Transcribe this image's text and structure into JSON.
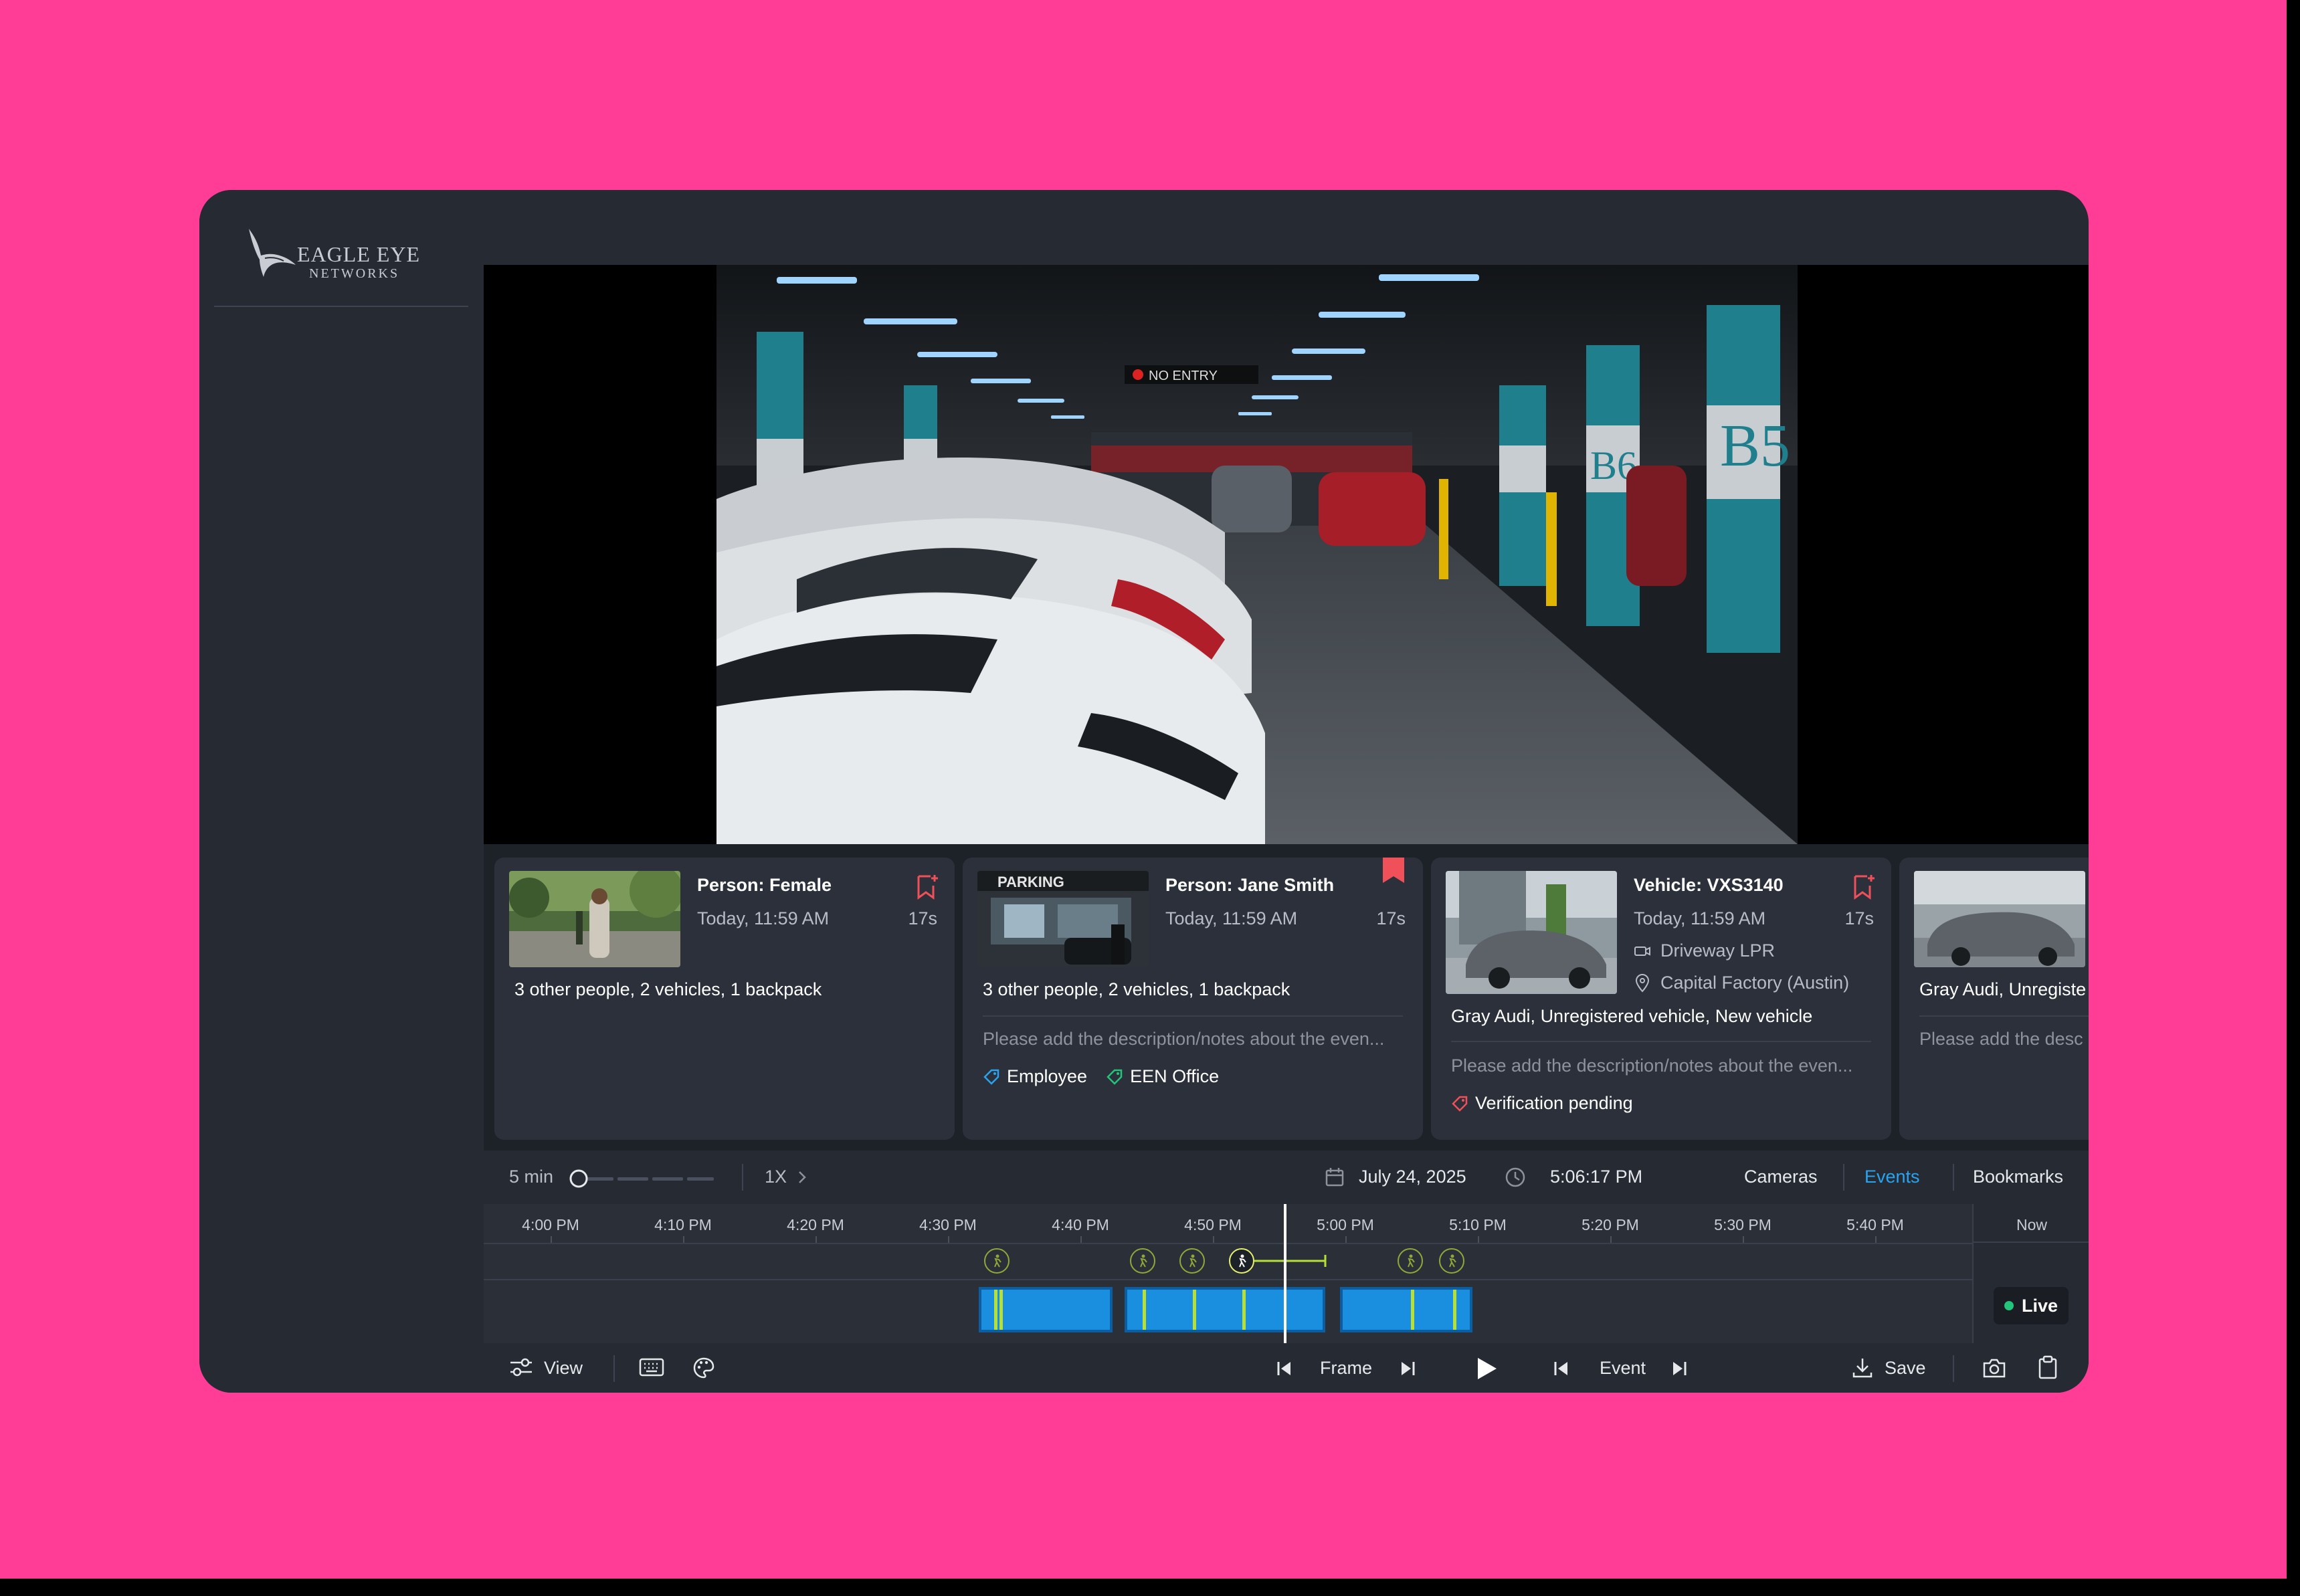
{
  "brand": {
    "name_line1": "EAGLE EYE",
    "name_line2": "NETWORKS"
  },
  "video": {
    "sign_text": "NO ENTRY",
    "pillar_label": "B5",
    "pillar_label2": "B6"
  },
  "events": [
    {
      "title": "Person: Female",
      "time": "Today, 11:59 AM",
      "duration": "17s",
      "summary": "3 other people, 2 vehicles, 1 backpack",
      "bookmarked": false
    },
    {
      "title": "Person: Jane Smith",
      "time": "Today, 11:59 AM",
      "duration": "17s",
      "summary": "3 other people, 2 vehicles, 1 backpack",
      "notes_placeholder": "Please add the description/notes about the even...",
      "thumb_text": "PARKING",
      "bookmarked": true,
      "tags": [
        {
          "label": "Employee",
          "color": "#2aa3f0"
        },
        {
          "label": "EEN Office",
          "color": "#22c57a"
        }
      ]
    },
    {
      "title": "Vehicle: VXS3140",
      "time": "Today, 11:59 AM",
      "duration": "17s",
      "camera": "Driveway LPR",
      "location": "Capital Factory (Austin)",
      "summary": "Gray Audi, Unregistered vehicle, New vehicle",
      "notes_placeholder": "Please add the description/notes about the even...",
      "bookmarked": false,
      "tags": [
        {
          "label": "Verification pending",
          "color": "#f0505a"
        }
      ]
    },
    {
      "summary": "Gray Audi, Unregiste",
      "notes_placeholder": "Please add the desc"
    }
  ],
  "toolbar": {
    "zoom_label": "5 min",
    "speed": "1X",
    "date": "July 24, 2025",
    "time": "5:06:17 PM",
    "tabs": [
      "Cameras",
      "Events",
      "Bookmarks"
    ],
    "active_tab": "Events"
  },
  "timeline": {
    "ticks": [
      "4:00 PM",
      "4:10 PM",
      "4:20 PM",
      "4:30 PM",
      "4:40 PM",
      "4:50 PM",
      "5:00 PM",
      "5:10 PM",
      "5:20 PM",
      "5:30 PM",
      "5:40 PM"
    ],
    "now_label": "Now",
    "live_label": "Live"
  },
  "bottombar": {
    "view_label": "View",
    "frame_label": "Frame",
    "event_label": "Event",
    "save_label": "Save"
  },
  "colors": {
    "background": "#ff3c96",
    "accent": "#1a8fe0",
    "event_marker": "#b7e036",
    "bookmark": "#f0505a"
  }
}
